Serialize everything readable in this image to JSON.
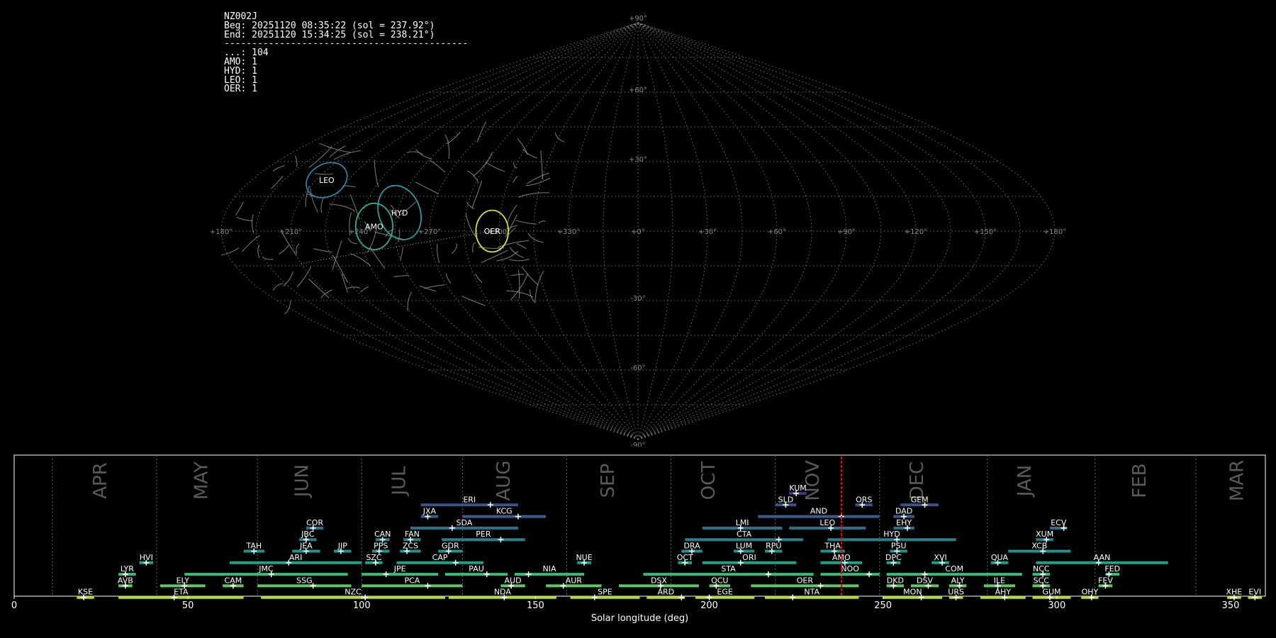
{
  "info": {
    "station": "NZ002J",
    "begin": "Beg: 20251120 08:35:22 (sol = 237.92°)",
    "end": "End: 20251120 15:34:25 (sol = 238.21°)",
    "separator": "--------------------------------------------",
    "counts": [
      {
        "code": "...",
        "count": 104
      },
      {
        "code": "AMO",
        "count": 1
      },
      {
        "code": "HYD",
        "count": 1
      },
      {
        "code": "LEO",
        "count": 1
      },
      {
        "code": "OER",
        "count": 1
      }
    ]
  },
  "colors": {
    "background": "#000000",
    "grid": "#8a8a8a",
    "leo": "#2f7fa0",
    "hyd": "#2b9a9a",
    "amo": "#2faa98",
    "oer": "#d8e03a",
    "current_marker": "#ff0000",
    "axis": "#ffffff",
    "month_label": "#5a5a5a"
  },
  "chart_data": [
    {
      "type": "scatter",
      "title": "",
      "projection": "sinusoidal all-sky (sun-centred ecliptic longitude/latitude)",
      "grid": true,
      "lon_tick_labels": [
        "+180°",
        "+150°",
        "+120°",
        "+90°",
        "+60°",
        "+30°",
        "+0°",
        "+330°",
        "+300°",
        "+270°",
        "+240°",
        "+210°",
        "+180°"
      ],
      "lat_tick_labels": [
        "+90°",
        "+60°",
        "+30°",
        "-30°",
        "-60°",
        "-90°"
      ],
      "radiants": [
        {
          "code": "LEO",
          "lon": 145,
          "lat": 22,
          "rlon": 10,
          "rlat": 7,
          "color": "leo"
        },
        {
          "code": "HYD",
          "lon": 104,
          "lat": 8,
          "rlon": 9,
          "rlat": 12,
          "color": "hyd"
        },
        {
          "code": "AMO",
          "lon": 114,
          "lat": 2,
          "rlon": 8,
          "rlat": 10,
          "color": "amo"
        },
        {
          "code": "OER",
          "lon": 63,
          "lat": 0,
          "rlon": 7,
          "rlat": 9,
          "color": "oer"
        }
      ],
      "trail_count": 104
    },
    {
      "type": "table",
      "xlabel": "Solar longitude (deg)",
      "xlim": [
        0,
        360
      ],
      "xticks": [
        0,
        50,
        100,
        150,
        200,
        250,
        300,
        350
      ],
      "current_sol": 238.06,
      "months": [
        {
          "label": "APR",
          "at": 25
        },
        {
          "label": "MAY",
          "at": 54
        },
        {
          "label": "JUN",
          "at": 83
        },
        {
          "label": "JUL",
          "at": 111
        },
        {
          "label": "AUG",
          "at": 141
        },
        {
          "label": "SEP",
          "at": 171
        },
        {
          "label": "OCT",
          "at": 200
        },
        {
          "label": "NOV",
          "at": 230
        },
        {
          "label": "DEC",
          "at": 260
        },
        {
          "label": "JAN",
          "at": 291
        },
        {
          "label": "FEB",
          "at": 324
        },
        {
          "label": "MAR",
          "at": 352
        }
      ],
      "month_dividers": [
        11,
        41,
        70,
        100,
        129,
        159,
        189,
        219,
        249,
        280,
        311,
        340
      ],
      "showers": [
        {
          "code": "KUM",
          "start": 223,
          "end": 228,
          "peak": 225,
          "row": 0
        },
        {
          "code": "ERI",
          "start": 117,
          "end": 145,
          "peak": 137,
          "row": 1
        },
        {
          "code": "SLD",
          "start": 219,
          "end": 225,
          "peak": 222,
          "row": 1
        },
        {
          "code": "ORS",
          "start": 242,
          "end": 247,
          "peak": 244,
          "row": 1
        },
        {
          "code": "GEM",
          "start": 255,
          "end": 266,
          "peak": 262,
          "row": 1
        },
        {
          "code": "JXA",
          "start": 117,
          "end": 122,
          "peak": 119,
          "row": 2
        },
        {
          "code": "KCG",
          "start": 129,
          "end": 153,
          "peak": 145,
          "row": 2
        },
        {
          "code": "AND",
          "start": 214,
          "end": 249,
          "peak": 238,
          "row": 2
        },
        {
          "code": "DAD",
          "start": 253,
          "end": 259,
          "peak": 256,
          "row": 2
        },
        {
          "code": "COR",
          "start": 84,
          "end": 89,
          "peak": 86,
          "row": 3
        },
        {
          "code": "SDA",
          "start": 114,
          "end": 145,
          "peak": 126,
          "row": 3
        },
        {
          "code": "LMI",
          "start": 198,
          "end": 221,
          "peak": 209,
          "row": 3
        },
        {
          "code": "LEO",
          "start": 223,
          "end": 245,
          "peak": 235,
          "row": 3
        },
        {
          "code": "EHY",
          "start": 253,
          "end": 259,
          "peak": 257,
          "row": 3
        },
        {
          "code": "ECV",
          "start": 298,
          "end": 303,
          "peak": 302,
          "row": 3
        },
        {
          "code": "JBC",
          "start": 82,
          "end": 87,
          "peak": 84,
          "row": 4
        },
        {
          "code": "CAN",
          "start": 104,
          "end": 108,
          "peak": 106,
          "row": 4
        },
        {
          "code": "FAN",
          "start": 112,
          "end": 117,
          "peak": 114,
          "row": 4
        },
        {
          "code": "PER",
          "start": 123,
          "end": 147,
          "peak": 140,
          "row": 4
        },
        {
          "code": "CTA",
          "start": 193,
          "end": 227,
          "peak": 220,
          "row": 4
        },
        {
          "code": "HYD",
          "start": 234,
          "end": 271,
          "peak": 254,
          "row": 4
        },
        {
          "code": "XUM",
          "start": 294,
          "end": 299,
          "peak": 297,
          "row": 4
        },
        {
          "code": "TAH",
          "start": 66,
          "end": 72,
          "peak": 69,
          "row": 5
        },
        {
          "code": "JEA",
          "start": 80,
          "end": 88,
          "peak": 84,
          "row": 5
        },
        {
          "code": "JIP",
          "start": 92,
          "end": 97,
          "peak": 94,
          "row": 5
        },
        {
          "code": "PPS",
          "start": 103,
          "end": 108,
          "peak": 105,
          "row": 5
        },
        {
          "code": "ZCS",
          "start": 111,
          "end": 117,
          "peak": 113,
          "row": 5
        },
        {
          "code": "GDR",
          "start": 122,
          "end": 129,
          "peak": 125,
          "row": 5
        },
        {
          "code": "DRA",
          "start": 192,
          "end": 198,
          "peak": 195,
          "row": 5
        },
        {
          "code": "LUM",
          "start": 207,
          "end": 213,
          "peak": 209,
          "row": 5
        },
        {
          "code": "RPU",
          "start": 216,
          "end": 221,
          "peak": 218,
          "row": 5
        },
        {
          "code": "THA",
          "start": 232,
          "end": 239,
          "peak": 236,
          "row": 5
        },
        {
          "code": "PSU",
          "start": 252,
          "end": 257,
          "peak": 254,
          "row": 5
        },
        {
          "code": "XCB",
          "start": 286,
          "end": 304,
          "peak": 296,
          "row": 5
        },
        {
          "code": "HVI",
          "start": 36,
          "end": 40,
          "peak": 38,
          "row": 6
        },
        {
          "code": "ARI",
          "start": 62,
          "end": 100,
          "peak": 79,
          "row": 6
        },
        {
          "code": "SZC",
          "start": 101,
          "end": 106,
          "peak": 104,
          "row": 6
        },
        {
          "code": "CAP",
          "start": 110,
          "end": 135,
          "peak": 127,
          "row": 6
        },
        {
          "code": "NUE",
          "start": 162,
          "end": 166,
          "peak": 164,
          "row": 6
        },
        {
          "code": "OCT",
          "start": 191,
          "end": 195,
          "peak": 193,
          "row": 6
        },
        {
          "code": "ORI",
          "start": 198,
          "end": 225,
          "peak": 209,
          "row": 6
        },
        {
          "code": "AMO",
          "start": 232,
          "end": 244,
          "peak": 239,
          "row": 6
        },
        {
          "code": "DPC",
          "start": 251,
          "end": 255,
          "peak": 253,
          "row": 6
        },
        {
          "code": "XVI",
          "start": 264,
          "end": 269,
          "peak": 267,
          "row": 6
        },
        {
          "code": "QUA",
          "start": 281,
          "end": 286,
          "peak": 283,
          "row": 6
        },
        {
          "code": "AAN",
          "start": 294,
          "end": 332,
          "peak": 312,
          "row": 6
        },
        {
          "code": "LYR",
          "start": 30,
          "end": 35,
          "peak": 32,
          "row": 7
        },
        {
          "code": "JMC",
          "start": 49,
          "end": 96,
          "peak": 74,
          "row": 7
        },
        {
          "code": "JPE",
          "start": 100,
          "end": 122,
          "peak": 107,
          "row": 7
        },
        {
          "code": "PAU",
          "start": 124,
          "end": 142,
          "peak": 136,
          "row": 7
        },
        {
          "code": "NIA",
          "start": 144,
          "end": 164,
          "peak": 148,
          "row": 7
        },
        {
          "code": "STA",
          "start": 181,
          "end": 230,
          "peak": 217,
          "row": 7
        },
        {
          "code": "NOO",
          "start": 232,
          "end": 249,
          "peak": 246,
          "row": 7
        },
        {
          "code": "COM",
          "start": 251,
          "end": 290,
          "peak": 262,
          "row": 7
        },
        {
          "code": "NCC",
          "start": 293,
          "end": 298,
          "peak": 296,
          "row": 7
        },
        {
          "code": "FED",
          "start": 314,
          "end": 318,
          "peak": 315,
          "row": 7
        },
        {
          "code": "AVB",
          "start": 30,
          "end": 34,
          "peak": 32,
          "row": 8
        },
        {
          "code": "ELY",
          "start": 42,
          "end": 55,
          "peak": 49,
          "row": 8
        },
        {
          "code": "CAM",
          "start": 60,
          "end": 66,
          "peak": 63,
          "row": 8
        },
        {
          "code": "SSG",
          "start": 70,
          "end": 97,
          "peak": 86,
          "row": 8
        },
        {
          "code": "PCA",
          "start": 100,
          "end": 129,
          "peak": 119,
          "row": 8
        },
        {
          "code": "AUD",
          "start": 140,
          "end": 147,
          "peak": 143,
          "row": 8
        },
        {
          "code": "AUR",
          "start": 153,
          "end": 169,
          "peak": 158,
          "row": 8
        },
        {
          "code": "DSX",
          "start": 174,
          "end": 197,
          "peak": 186,
          "row": 8
        },
        {
          "code": "OCU",
          "start": 200,
          "end": 206,
          "peak": 202,
          "row": 8
        },
        {
          "code": "OER",
          "start": 212,
          "end": 243,
          "peak": 232,
          "row": 8
        },
        {
          "code": "DKD",
          "start": 251,
          "end": 256,
          "peak": 253,
          "row": 8
        },
        {
          "code": "DSV",
          "start": 258,
          "end": 266,
          "peak": 263,
          "row": 8
        },
        {
          "code": "ALY",
          "start": 269,
          "end": 274,
          "peak": 272,
          "row": 8
        },
        {
          "code": "ILE",
          "start": 279,
          "end": 288,
          "peak": 283,
          "row": 8
        },
        {
          "code": "SCC",
          "start": 293,
          "end": 298,
          "peak": 296,
          "row": 8
        },
        {
          "code": "FEV",
          "start": 312,
          "end": 316,
          "peak": 314,
          "row": 8
        },
        {
          "code": "KSE",
          "start": 18,
          "end": 23,
          "peak": 20,
          "row": 9
        },
        {
          "code": "ETA",
          "start": 30,
          "end": 66,
          "peak": 46,
          "row": 9
        },
        {
          "code": "NZC",
          "start": 71,
          "end": 124,
          "peak": 101,
          "row": 9
        },
        {
          "code": "NDA",
          "start": 125,
          "end": 156,
          "peak": 141,
          "row": 9
        },
        {
          "code": "SPE",
          "start": 160,
          "end": 180,
          "peak": 167,
          "row": 9
        },
        {
          "code": "ARD",
          "start": 182,
          "end": 193,
          "peak": 192,
          "row": 9
        },
        {
          "code": "EGE",
          "start": 196,
          "end": 213,
          "peak": 200,
          "row": 9
        },
        {
          "code": "NTA",
          "start": 216,
          "end": 243,
          "peak": 224,
          "row": 9
        },
        {
          "code": "MON",
          "start": 250,
          "end": 267,
          "peak": 261,
          "row": 9
        },
        {
          "code": "URS",
          "start": 269,
          "end": 273,
          "peak": 271,
          "row": 9
        },
        {
          "code": "AHY",
          "start": 278,
          "end": 291,
          "peak": 285,
          "row": 9
        },
        {
          "code": "GUM",
          "start": 293,
          "end": 304,
          "peak": 298,
          "row": 9
        },
        {
          "code": "OHY",
          "start": 307,
          "end": 312,
          "peak": 310,
          "row": 9
        },
        {
          "code": "XHE",
          "start": 349,
          "end": 353,
          "peak": 351,
          "row": 9
        },
        {
          "code": "EVI",
          "start": 355,
          "end": 359,
          "peak": 357,
          "row": 9
        }
      ]
    }
  ]
}
